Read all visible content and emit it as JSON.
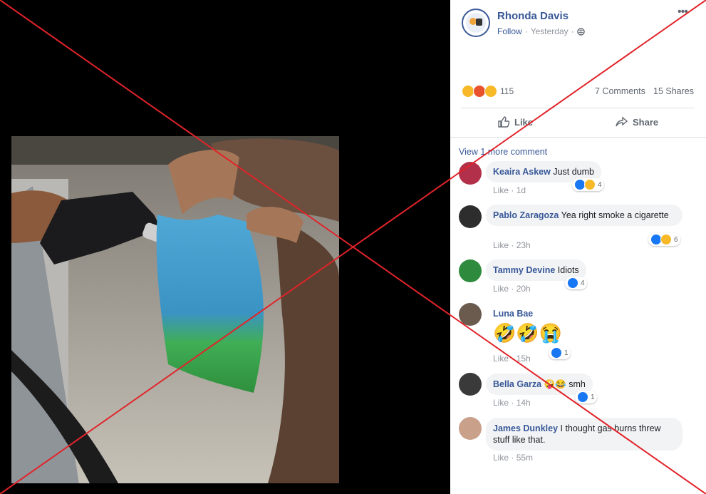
{
  "post": {
    "author": "Rhonda Davis",
    "follow_label": "Follow",
    "separator": "·",
    "time": "Yesterday",
    "reaction_count": "115",
    "comments": "7 Comments",
    "shares": "15 Shares",
    "like_label": "Like",
    "share_label": "Share",
    "view_more": "View 1 more comment"
  },
  "comments": [
    {
      "author": "Keaira Askew",
      "text": "Just dumb",
      "like": "Like",
      "time": "1d",
      "react_count": "4"
    },
    {
      "author": "Pablo Zaragoza",
      "text": "Yea right smoke a cigarette",
      "like": "Like",
      "time": "23h",
      "react_count": "6"
    },
    {
      "author": "Tammy Devine",
      "text": "Idiots",
      "like": "Like",
      "time": "20h",
      "react_count": "4"
    },
    {
      "author": "Luna Bae",
      "text": "",
      "like": "Like",
      "time": "15h",
      "react_count": "1",
      "emojis": "🤣🤣😭"
    },
    {
      "author": "Bella Garza",
      "text": "smh",
      "like": "Like",
      "time": "14h",
      "react_count": "1",
      "emojis": "🤪😂"
    },
    {
      "author": "James Dunkley",
      "text": "I thought gas burns threw stuff like that.",
      "like": "Like",
      "time": "55m"
    }
  ],
  "colors": {
    "link": "#385898",
    "facebook_blue": "#1877f2",
    "cross_red": "#e0242a"
  },
  "icons": [
    "more-icon",
    "globe-icon",
    "like-icon",
    "share-icon"
  ]
}
